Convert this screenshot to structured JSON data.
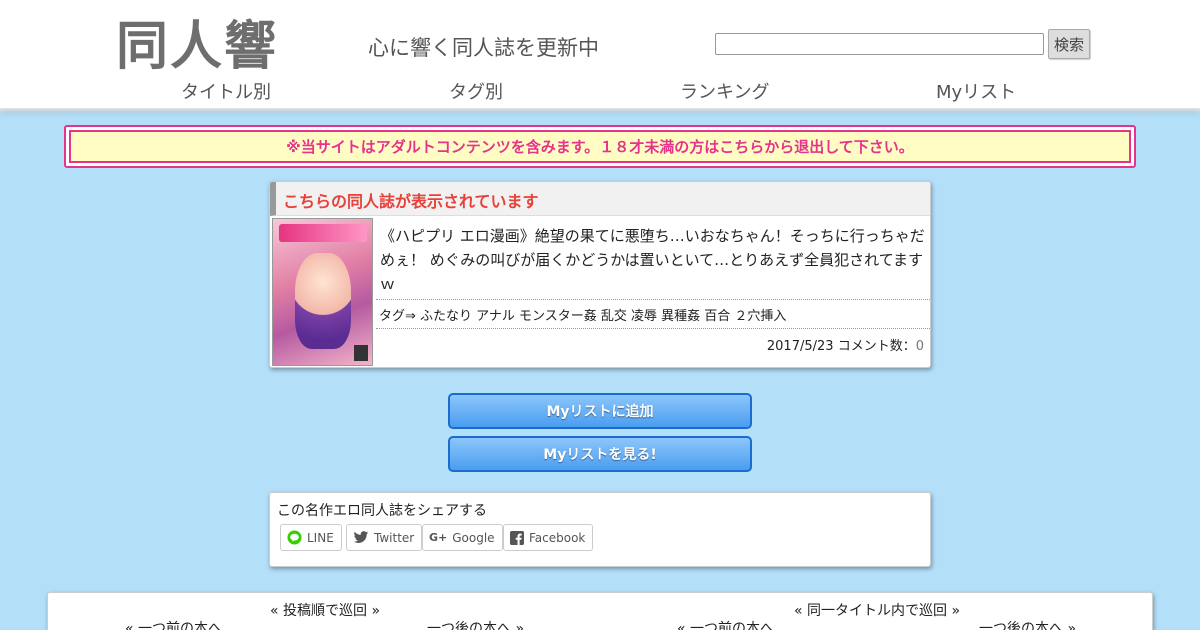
{
  "header": {
    "logo": "同人響",
    "tagline": "心に響く同人誌を更新中",
    "search_button": "検索",
    "nav": [
      "タイトル別",
      "タグ別",
      "ランキング",
      "Myリスト"
    ]
  },
  "warning": "※当サイトはアダルトコンテンツを含みます。１８才未満の方はこちらから退出して下さい。",
  "book": {
    "heading": "こちらの同人誌が表示されています",
    "description": "《ハピプリ エロ漫画》絶望の果てに悪堕ち…いおなちゃん！そっちに行っちゃだめぇ！ めぐみの叫びが届くかどうかは置いといて…とりあえず全員犯されてますｗ",
    "tags": "タグ⇒ ふたなり アナル モンスター姦 乱交 凌辱 異種姦 百合 ２穴挿入",
    "date": "2017/5/23",
    "comment_label": "コメント数：",
    "comment_count": "0"
  },
  "buttons": {
    "add_mylist": "Myリストに追加",
    "view_mylist": "Myリストを見る!"
  },
  "share": {
    "title": "この名作エロ同人誌をシェアする",
    "line": "LINE",
    "twitter": "Twitter",
    "google": "Google",
    "facebook": "Facebook"
  },
  "pager": {
    "by_post": "« 投稿順で巡回 »",
    "by_title": "« 同一タイトル内で巡回 »",
    "prev": "« 一つ前の本へ",
    "next": "一つ後の本へ »"
  },
  "colors": {
    "background": "#b3dff9",
    "warning_pink": "#e6338c",
    "heading_red": "#e8413a",
    "button_blue": "#4a9df0"
  }
}
